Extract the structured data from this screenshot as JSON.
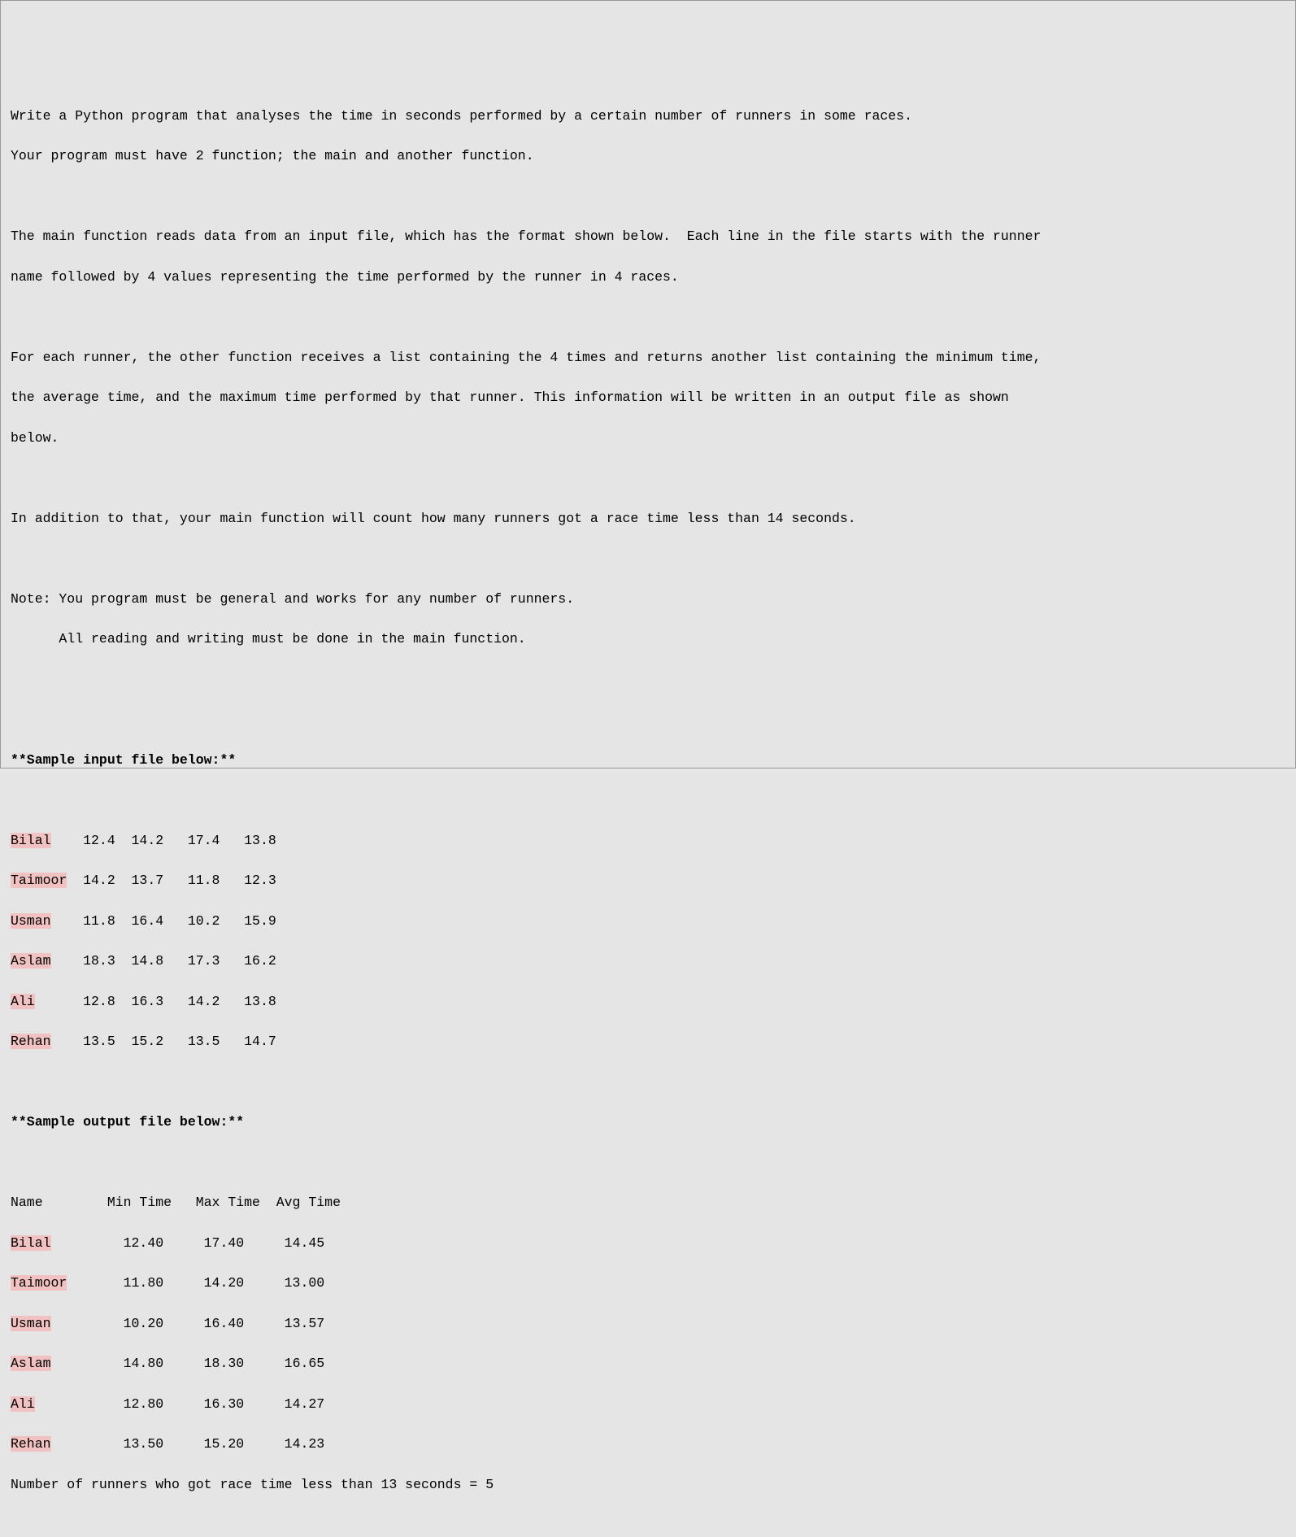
{
  "instructions": {
    "p1_l1": "Write a Python program that analyses the time in seconds performed by a certain number of runners in some races.",
    "p1_l2": "Your program must have 2 function; the main and another function.",
    "p2_l1": "The main function reads data from an input file, which has the format shown below.  Each line in the file starts with the runner",
    "p2_l2": "name followed by 4 values representing the time performed by the runner in 4 races.",
    "p3_l1": "For each runner, the other function receives a list containing the 4 times and returns another list containing the minimum time,",
    "p3_l2": "the average time, and the maximum time performed by that runner. This information will be written in an output file as shown",
    "p3_l3": "below.",
    "p4_l1": "In addition to that, your main function will count how many runners got a race time less than 14 seconds.",
    "note_l1": "Note: You program must be general and works for any number of runners.",
    "note_l2": "      All reading and writing must be done in the main function."
  },
  "headers": {
    "sample_input": "**Sample input file below:**",
    "sample_output": "**Sample output file below:**"
  },
  "input_data": {
    "rows": [
      {
        "name": "Bilal",
        "rest": "    12.4  14.2   17.4   13.8"
      },
      {
        "name": "Taimoor",
        "rest": "  14.2  13.7   11.8   12.3"
      },
      {
        "name": "Usman",
        "rest": "    11.8  16.4   10.2   15.9"
      },
      {
        "name": "Aslam",
        "rest": "    18.3  14.8   17.3   16.2"
      },
      {
        "name": "Ali",
        "rest": "      12.8  16.3   14.2   13.8"
      },
      {
        "name": "Rehan",
        "rest": "    13.5  15.2   13.5   14.7"
      }
    ]
  },
  "output_data": {
    "header_line": "Name        Min Time   Max Time  Avg Time",
    "rows": [
      {
        "name": "Bilal",
        "rest": "         12.40     17.40     14.45"
      },
      {
        "name": "Taimoor",
        "rest": "       11.80     14.20     13.00"
      },
      {
        "name": "Usman",
        "rest": "         10.20     16.40     13.57"
      },
      {
        "name": "Aslam",
        "rest": "         14.80     18.30     16.65"
      },
      {
        "name": "Ali",
        "rest": "           12.80     16.30     14.27"
      },
      {
        "name": "Rehan",
        "rest": "         13.50     15.20     14.23"
      }
    ],
    "summary": "Number of runners who got race time less than 13 seconds = 5"
  },
  "structured_data": {
    "input_runners": [
      {
        "name": "Bilal",
        "times": [
          12.4,
          14.2,
          17.4,
          13.8
        ]
      },
      {
        "name": "Taimoor",
        "times": [
          14.2,
          13.7,
          11.8,
          12.3
        ]
      },
      {
        "name": "Usman",
        "times": [
          11.8,
          16.4,
          10.2,
          15.9
        ]
      },
      {
        "name": "Aslam",
        "times": [
          18.3,
          14.8,
          17.3,
          16.2
        ]
      },
      {
        "name": "Ali",
        "times": [
          12.8,
          16.3,
          14.2,
          13.8
        ]
      },
      {
        "name": "Rehan",
        "times": [
          13.5,
          15.2,
          13.5,
          14.7
        ]
      }
    ],
    "output_columns": [
      "Name",
      "Min Time",
      "Max Time",
      "Avg Time"
    ],
    "output_runners": [
      {
        "name": "Bilal",
        "min": 12.4,
        "max": 17.4,
        "avg": 14.45
      },
      {
        "name": "Taimoor",
        "min": 11.8,
        "max": 14.2,
        "avg": 13.0
      },
      {
        "name": "Usman",
        "min": 10.2,
        "max": 16.4,
        "avg": 13.57
      },
      {
        "name": "Aslam",
        "min": 14.8,
        "max": 18.3,
        "avg": 16.65
      },
      {
        "name": "Ali",
        "min": 12.8,
        "max": 16.3,
        "avg": 14.27
      },
      {
        "name": "Rehan",
        "min": 13.5,
        "max": 15.2,
        "avg": 14.23
      }
    ],
    "runners_under_13_seconds": 5
  }
}
